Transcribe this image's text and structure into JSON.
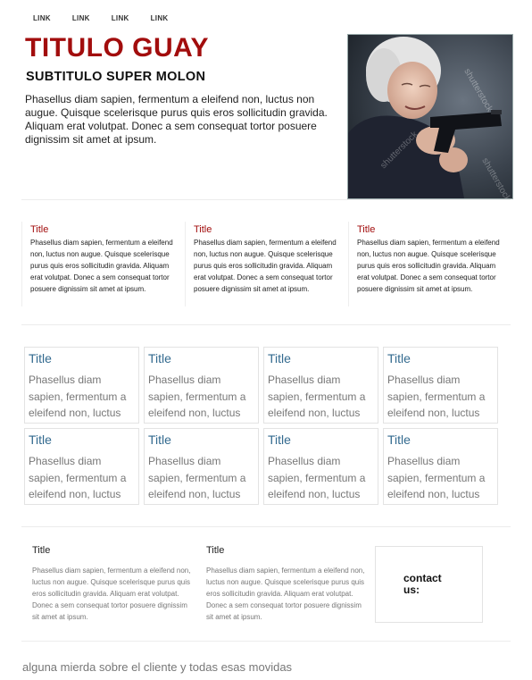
{
  "nav": {
    "links": [
      "LINK",
      "LINK",
      "LINK",
      "LINK"
    ]
  },
  "hero": {
    "title": "TITULO GUAY",
    "subtitle": "SUBTITULO SUPER MOLON",
    "text": "Phasellus diam sapien, fermentum a eleifend non, luctus non augue. Quisque scelerisque purus quis eros sollicitudin gravida. Aliquam erat volutpat. Donec a sem consequat tortor posuere dignissim sit amet at ipsum.",
    "image_watermark": "shutterstock"
  },
  "columns": [
    {
      "title": "Title",
      "text": "Phasellus diam sapien, fermentum a eleifend non, luctus non augue. Quisque scelerisque purus quis eros sollicitudin gravida. Aliquam erat volutpat. Donec a sem consequat tortor posuere dignissim sit amet at ipsum."
    },
    {
      "title": "Title",
      "text": "Phasellus diam sapien, fermentum a eleifend non, luctus non augue. Quisque scelerisque purus quis eros sollicitudin gravida. Aliquam erat volutpat. Donec a sem consequat tortor posuere dignissim sit amet at ipsum."
    },
    {
      "title": "Title",
      "text": "Phasellus diam sapien, fermentum a eleifend non, luctus non augue. Quisque scelerisque purus quis eros sollicitudin gravida. Aliquam erat volutpat. Donec a sem consequat tortor posuere dignissim sit amet at ipsum."
    }
  ],
  "cards": [
    {
      "title": "Title",
      "text": "Phasellus diam sapien, fermentum a eleifend non, luctus"
    },
    {
      "title": "Title",
      "text": "Phasellus diam sapien, fermentum a eleifend non, luctus"
    },
    {
      "title": "Title",
      "text": "Phasellus diam sapien, fermentum a eleifend non, luctus"
    },
    {
      "title": "Title",
      "text": "Phasellus diam sapien, fermentum a eleifend non, luctus"
    },
    {
      "title": "Title",
      "text": "Phasellus diam sapien, fermentum a eleifend non, luctus"
    },
    {
      "title": "Title",
      "text": "Phasellus diam sapien, fermentum a eleifend non, luctus"
    },
    {
      "title": "Title",
      "text": "Phasellus diam sapien, fermentum a eleifend non, luctus"
    },
    {
      "title": "Title",
      "text": "Phasellus diam sapien, fermentum a eleifend non, luctus"
    }
  ],
  "footer_columns": [
    {
      "title": "Title",
      "text": "Phasellus diam sapien, fermentum a eleifend non, luctus non augue. Quisque scelerisque purus quis eros sollicitudin gravida. Aliquam erat volutpat. Donec a sem consequat tortor posuere dignissim sit amet at ipsum."
    },
    {
      "title": "Title",
      "text": "Phasellus diam sapien, fermentum a eleifend non, luctus non augue. Quisque scelerisque purus quis eros sollicitudin gravida. Aliquam erat volutpat. Donec a sem consequat tortor posuere dignissim sit amet at ipsum."
    }
  ],
  "contact": {
    "label": "contact us:"
  },
  "tagline": "alguna mierda sobre el cliente y todas esas movidas",
  "colors": {
    "accent": "#a20d0d",
    "card_title": "#336a8f",
    "muted_text": "#777777",
    "border": "#e3e3e3"
  },
  "icons": [
    "hero-photo"
  ]
}
